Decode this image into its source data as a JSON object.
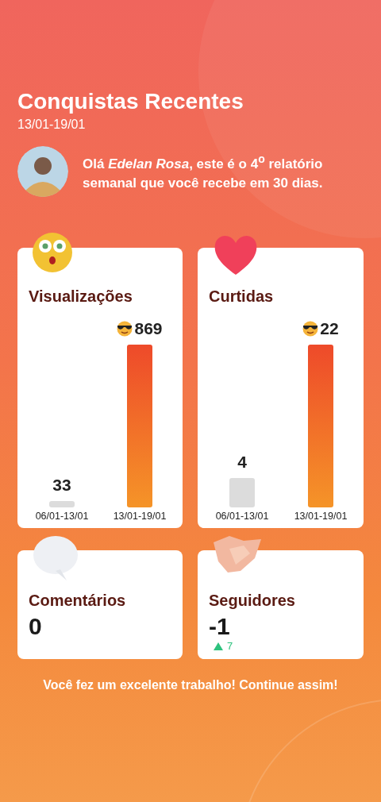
{
  "header": {
    "title": "Conquistas Recentes",
    "date_range": "13/01-19/01"
  },
  "greeting": "Olá *Edelan Rosa*, este é o **4**$^{o}$ relatório semanal que você recebe em 30 dias.",
  "chart_cards": [
    {
      "kind": "surprised",
      "title": "Visualizações",
      "chart_data": {
        "type": "bar",
        "categories": [
          "06/01-13/01",
          "13/01-19/01"
        ],
        "values": [
          33,
          869
        ],
        "data_labels": true
      }
    },
    {
      "kind": "heart",
      "title": "Curtidas",
      "chart_data": {
        "type": "bar",
        "categories": [
          "06/01-13/01",
          "13/01-19/01"
        ],
        "values": [
          4,
          22
        ],
        "data_labels": true
      }
    }
  ],
  "stat_cards": [
    {
      "kind": "speech",
      "title": "Comentários",
      "value": "0"
    },
    {
      "kind": "handshake",
      "title": "Seguidores",
      "value": "-1",
      "up": true,
      "change": "7"
    }
  ],
  "footer": "Você fez um excelente trabalho! Continue assim!"
}
